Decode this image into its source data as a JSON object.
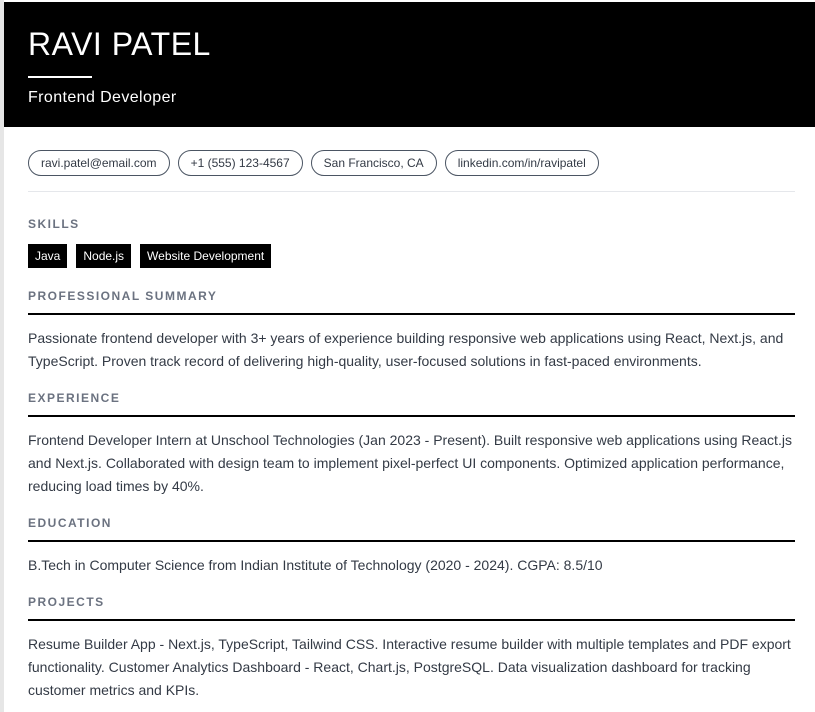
{
  "resume": {
    "name": "RAVI PATEL",
    "role": "Frontend Developer"
  },
  "contacts": [
    {
      "label": "ravi.patel@email.com"
    },
    {
      "label": "+1 (555) 123-4567"
    },
    {
      "label": "San Francisco, CA"
    },
    {
      "label": "linkedin.com/in/ravipatel"
    }
  ],
  "skills": {
    "title": "SKILLS",
    "items": [
      "Java",
      "Node.js",
      "Website Development"
    ]
  },
  "summary": {
    "title": "PROFESSIONAL SUMMARY",
    "text": "Passionate frontend developer with 3+ years of experience building responsive web applications using React, Next.js, and TypeScript. Proven track record of delivering high-quality, user-focused solutions in fast-paced environments."
  },
  "experience": {
    "title": "EXPERIENCE",
    "text": "Frontend Developer Intern at Unschool Technologies (Jan 2023 - Present). Built responsive web applications using React.js and Next.js. Collaborated with design team to implement pixel-perfect UI components. Optimized application performance, reducing load times by 40%."
  },
  "education": {
    "title": "EDUCATION",
    "text": "B.Tech in Computer Science from Indian Institute of Technology (2020 - 2024). CGPA: 8.5/10"
  },
  "projects": {
    "title": "PROJECTS",
    "text": "Resume Builder App - Next.js, TypeScript, Tailwind CSS. Interactive resume builder with multiple templates and PDF export functionality. Customer Analytics Dashboard - React, Chart.js, PostgreSQL. Data visualization dashboard for tracking customer metrics and KPIs."
  }
}
